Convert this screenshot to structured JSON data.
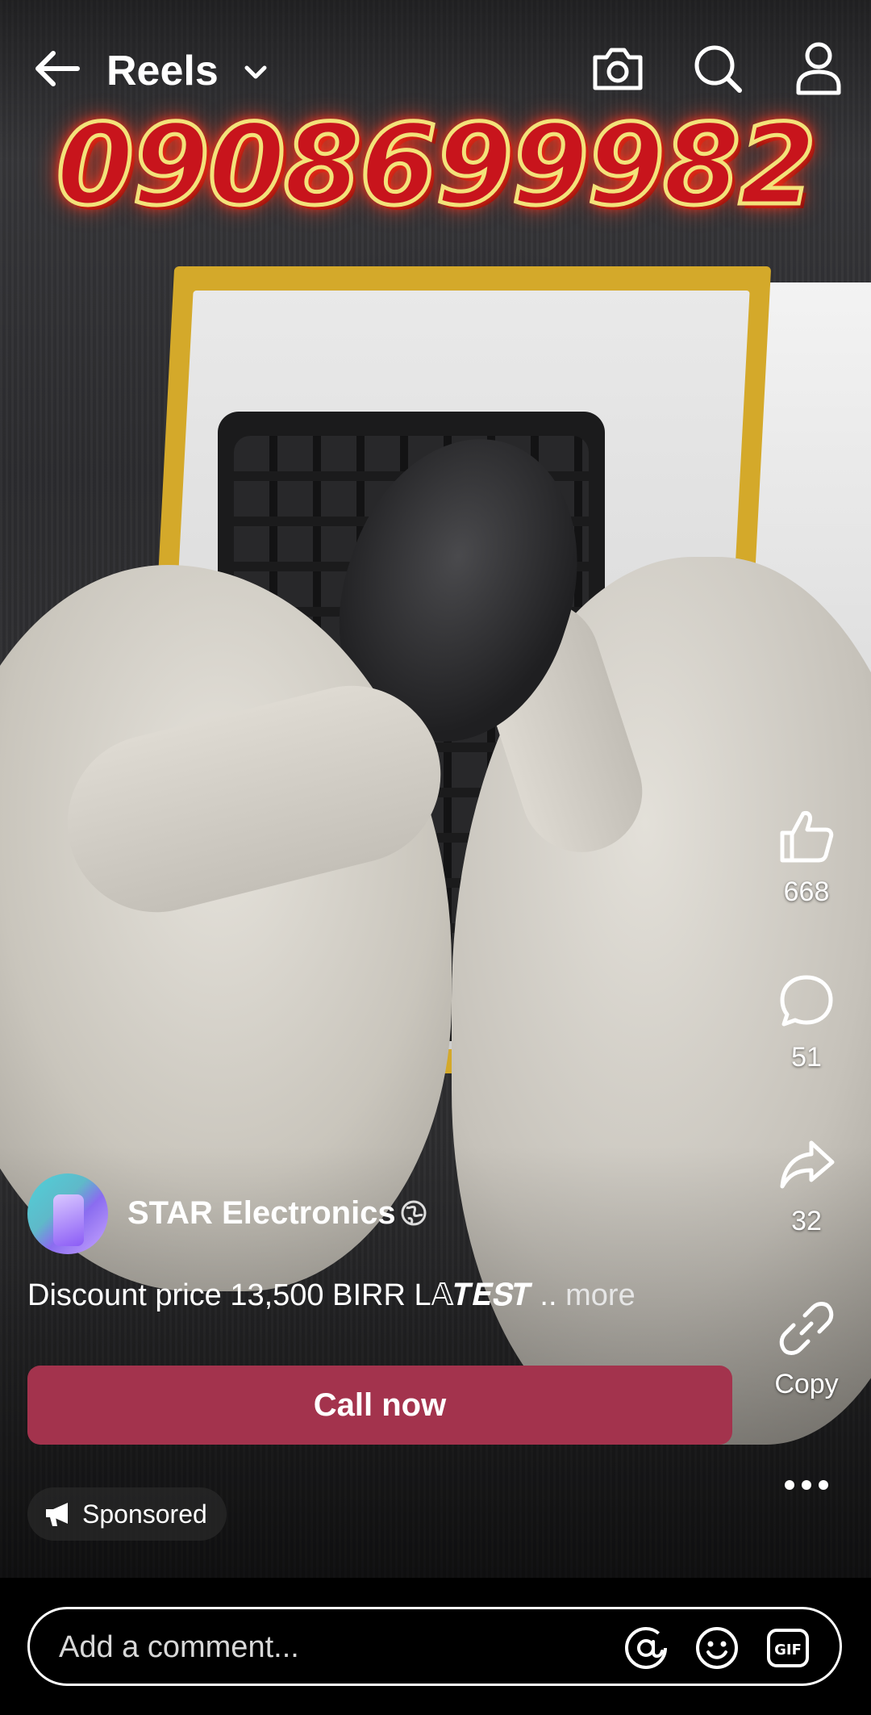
{
  "header": {
    "title": "Reels",
    "icons": [
      "back-arrow-icon",
      "chevron-down-icon",
      "camera-icon",
      "search-icon",
      "profile-icon"
    ]
  },
  "video": {
    "overlay_text": "0908699982"
  },
  "actions": {
    "like_count": "668",
    "comment_count": "51",
    "share_count": "32",
    "copy_label": "Copy"
  },
  "post": {
    "page_name": "STAR Electronics",
    "caption": "Discount price 13,500 BIRR  L𝔸𝑻𝑬𝑺𝑻 ..",
    "more_label": "more",
    "cta_label": "Call now",
    "sponsored_label": "Sponsored"
  },
  "comment_bar": {
    "placeholder": "Add a comment..."
  },
  "colors": {
    "cta": "#a3334d",
    "background": "#000000",
    "text": "#ffffff"
  }
}
